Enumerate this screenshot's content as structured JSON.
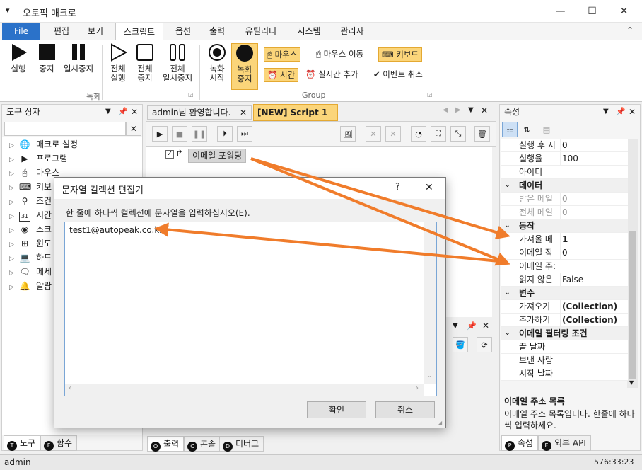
{
  "window": {
    "title": "오토픽 매크로",
    "menu_glyph": "▾",
    "minimize": "—",
    "maximize": "☐",
    "close": "✕"
  },
  "menu": {
    "tabs": [
      "File",
      "편집",
      "보기",
      "스크립트",
      "옵션",
      "출력",
      "유틸리티",
      "시스템",
      "관리자"
    ],
    "active": "스크립트",
    "collapse_glyph": "⌃"
  },
  "ribbon": {
    "record_group_label": "녹화",
    "group_label": "Group",
    "buttons": {
      "run": "실행",
      "stop": "중지",
      "pause": "일시중지",
      "run_all": [
        "전체",
        "실행"
      ],
      "stop_all": [
        "전체",
        "중지"
      ],
      "pause_all": [
        "전체",
        "일시중지"
      ],
      "rec_start": [
        "녹화",
        "시작"
      ],
      "rec_stop": [
        "녹화",
        "중지"
      ]
    },
    "mouse": "마우스",
    "mouse_move": "마우스 이동",
    "keyboard": "키보드",
    "time": "시간",
    "realtime_add": "실시간 추가",
    "event_cancel": "이벤트 취소"
  },
  "toolbox": {
    "title": "도구 상자",
    "items": [
      {
        "label": "매크로 설정",
        "icon": "globe-icon"
      },
      {
        "label": "프로그램",
        "icon": "program-icon"
      },
      {
        "label": "마우스",
        "icon": "mouse-icon"
      },
      {
        "label": "키보",
        "icon": "keyboard-icon"
      },
      {
        "label": "조건",
        "icon": "location-icon"
      },
      {
        "label": "시간",
        "icon": "calendar-icon"
      },
      {
        "label": "스크",
        "icon": "eye-icon"
      },
      {
        "label": "윈도",
        "icon": "windows-icon"
      },
      {
        "label": "하드",
        "icon": "laptop-icon"
      },
      {
        "label": "메세",
        "icon": "message-icon"
      },
      {
        "label": "알람",
        "icon": "bell-icon"
      }
    ],
    "calendar_num": "31",
    "tab_tools": "도구",
    "tab_tools_badge": "T",
    "tab_functions": "함수",
    "tab_functions_badge": "F"
  },
  "editor": {
    "tabs": [
      {
        "label": "admin님 환영합니다.",
        "active": false
      },
      {
        "label": "[NEW] Script 1",
        "active": true
      }
    ],
    "node_label": "이메일 포워딩"
  },
  "output": {
    "tabs": [
      {
        "label": "출력",
        "badge": "O"
      },
      {
        "label": "콘솔",
        "badge": "C"
      },
      {
        "label": "디버그",
        "badge": "D"
      }
    ]
  },
  "properties": {
    "title": "속성",
    "rows": [
      {
        "type": "prop",
        "name": "실행 후 지",
        "value": "0"
      },
      {
        "type": "prop",
        "name": "실행율",
        "value": "100"
      },
      {
        "type": "prop",
        "name": "아이디",
        "value": ""
      },
      {
        "type": "cat",
        "name": "데이터"
      },
      {
        "type": "prop",
        "name": "받은 메일",
        "value": "0",
        "dim": true
      },
      {
        "type": "prop",
        "name": "전체 메일",
        "value": "0",
        "dim": true
      },
      {
        "type": "cat",
        "name": "동작"
      },
      {
        "type": "prop",
        "name": "가져올 메",
        "value": "1",
        "bold": true
      },
      {
        "type": "prop",
        "name": "이메일 작",
        "value": "0"
      },
      {
        "type": "prop",
        "name": "이메일 주:",
        "value": ""
      },
      {
        "type": "prop",
        "name": "읽지 않은",
        "value": "False"
      },
      {
        "type": "cat",
        "name": "변수"
      },
      {
        "type": "prop",
        "name": "가져오기",
        "value": "(Collection)",
        "bold": true
      },
      {
        "type": "prop",
        "name": "추가하기",
        "value": "(Collection)",
        "bold": true
      },
      {
        "type": "cat",
        "name": "이메일 필터링 조건"
      },
      {
        "type": "prop",
        "name": "끝 날짜",
        "value": ""
      },
      {
        "type": "prop",
        "name": "보낸 사람",
        "value": ""
      },
      {
        "type": "prop",
        "name": "시작 날짜",
        "value": ""
      }
    ],
    "desc_title": "이메일 주소 목록",
    "desc_text": "이메일 주소 목록입니다. 한줄에 하나씩 입력하세요.",
    "tab_props": "속성",
    "tab_props_badge": "P",
    "tab_api": "외부 API",
    "tab_api_badge": "E"
  },
  "dialog": {
    "title": "문자열 컬렉션 편집기",
    "help": "?",
    "close": "✕",
    "instruction": "한 줄에 하나씩 컬렉션에 문자열을 입력하십시오(E).",
    "text_value": "test1@autopeak.co.kr",
    "ok": "확인",
    "cancel": "취소"
  },
  "status": {
    "user": "admin",
    "coords": "576:33:23"
  },
  "colors": {
    "accent": "#2b72c9",
    "highlight": "#fbd57a",
    "arrow": "#f07c2b"
  }
}
